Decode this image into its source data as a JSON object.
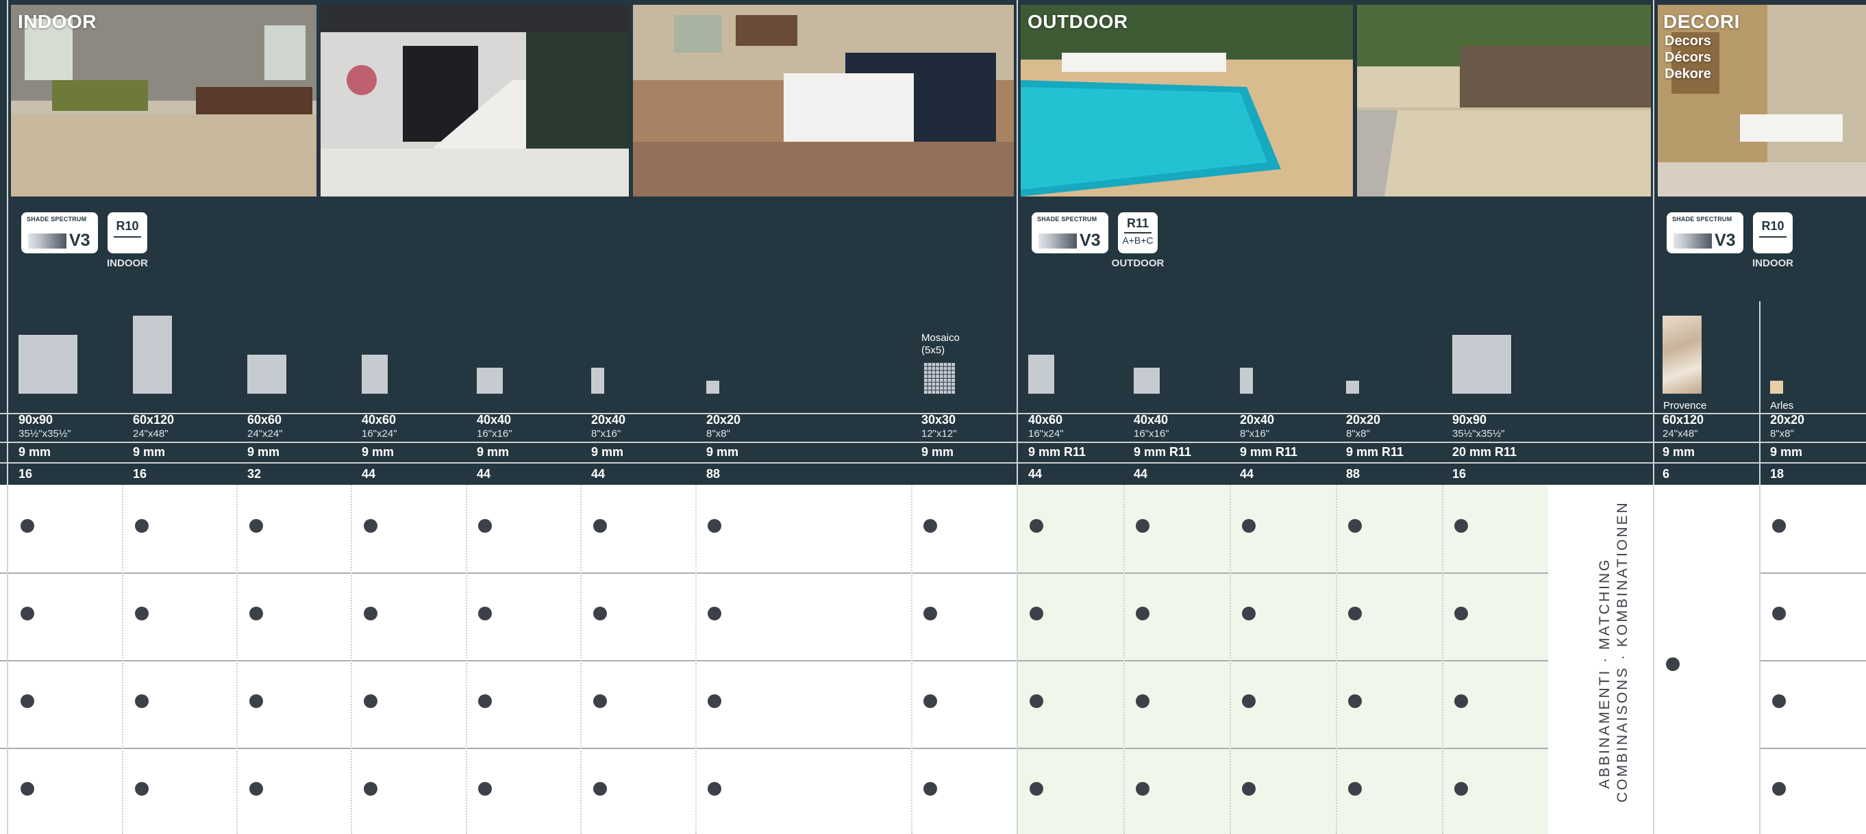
{
  "sections": {
    "indoor": "INDOOR",
    "outdoor": "OUTDOOR",
    "decori": "DECORI",
    "decori_sub": [
      "Decors",
      "Décors",
      "Dekore"
    ]
  },
  "badges": {
    "shade_spectrum": "SHADE SPECTRUM",
    "shade_value": "V3",
    "indoor_r": "R10",
    "outdoor_r": "R11",
    "outdoor_abc": "A+B+C",
    "indoor_label": "INDOOR",
    "outdoor_label": "OUTDOOR"
  },
  "mosaico": {
    "line1": "Mosaico",
    "line2": "(5x5)"
  },
  "decor_labels": [
    "Provence",
    "Arles"
  ],
  "columns": [
    {
      "size": "90x90",
      "inch": "35½\"x35½\"",
      "thick": "9 mm",
      "qty": "16",
      "rows": [
        1,
        1,
        1,
        1
      ]
    },
    {
      "size": "60x120",
      "inch": "24\"x48\"",
      "thick": "9 mm",
      "qty": "16",
      "rows": [
        1,
        1,
        1,
        1
      ]
    },
    {
      "size": "60x60",
      "inch": "24\"x24\"",
      "thick": "9 mm",
      "qty": "32",
      "rows": [
        1,
        1,
        1,
        1
      ]
    },
    {
      "size": "40x60",
      "inch": "16\"x24\"",
      "thick": "9 mm",
      "qty": "44",
      "rows": [
        1,
        1,
        1,
        1
      ]
    },
    {
      "size": "40x40",
      "inch": "16\"x16\"",
      "thick": "9 mm",
      "qty": "44",
      "rows": [
        1,
        1,
        1,
        1
      ]
    },
    {
      "size": "20x40",
      "inch": "8\"x16\"",
      "thick": "9 mm",
      "qty": "44",
      "rows": [
        1,
        1,
        1,
        1
      ]
    },
    {
      "size": "20x20",
      "inch": "8\"x8\"",
      "thick": "9 mm",
      "qty": "88",
      "rows": [
        1,
        1,
        1,
        1
      ]
    },
    {
      "size": "30x30",
      "inch": "12\"x12\"",
      "thick": "9 mm",
      "qty": "",
      "rows": [
        1,
        1,
        1,
        1
      ]
    },
    {
      "size": "40x60",
      "inch": "16\"x24\"",
      "thick": "9 mm R11",
      "qty": "44",
      "rows": [
        1,
        1,
        1,
        1
      ]
    },
    {
      "size": "40x40",
      "inch": "16\"x16\"",
      "thick": "9 mm R11",
      "qty": "44",
      "rows": [
        1,
        1,
        1,
        1
      ]
    },
    {
      "size": "20x40",
      "inch": "8\"x16\"",
      "thick": "9 mm R11",
      "qty": "44",
      "rows": [
        1,
        1,
        1,
        1
      ]
    },
    {
      "size": "20x20",
      "inch": "8\"x8\"",
      "thick": "9 mm R11",
      "qty": "88",
      "rows": [
        1,
        1,
        1,
        1
      ]
    },
    {
      "size": "90x90",
      "inch": "35½\"x35½\"",
      "thick": "20 mm R11",
      "qty": "16",
      "rows": [
        1,
        1,
        1,
        1
      ]
    },
    {
      "size": "60x120",
      "inch": "24\"x48\"",
      "thick": "9 mm",
      "qty": "6",
      "rows": [
        0,
        0,
        1,
        0
      ]
    },
    {
      "size": "20x20",
      "inch": "8\"x8\"",
      "thick": "9 mm",
      "qty": "18",
      "rows": [
        1,
        1,
        1,
        1
      ]
    }
  ],
  "matching_vertical": {
    "line1": "ABBINAMENTI  ·  MATCHING",
    "line2": "COMBINAISONS  ·  KOMBINATIONEN"
  },
  "colors": {
    "navy": "#243640",
    "tile": "#c6cbd2",
    "outdoor_bg": "#f0f6ea",
    "dot": "#3c4149",
    "arles_tile": "#e6cfa9"
  }
}
